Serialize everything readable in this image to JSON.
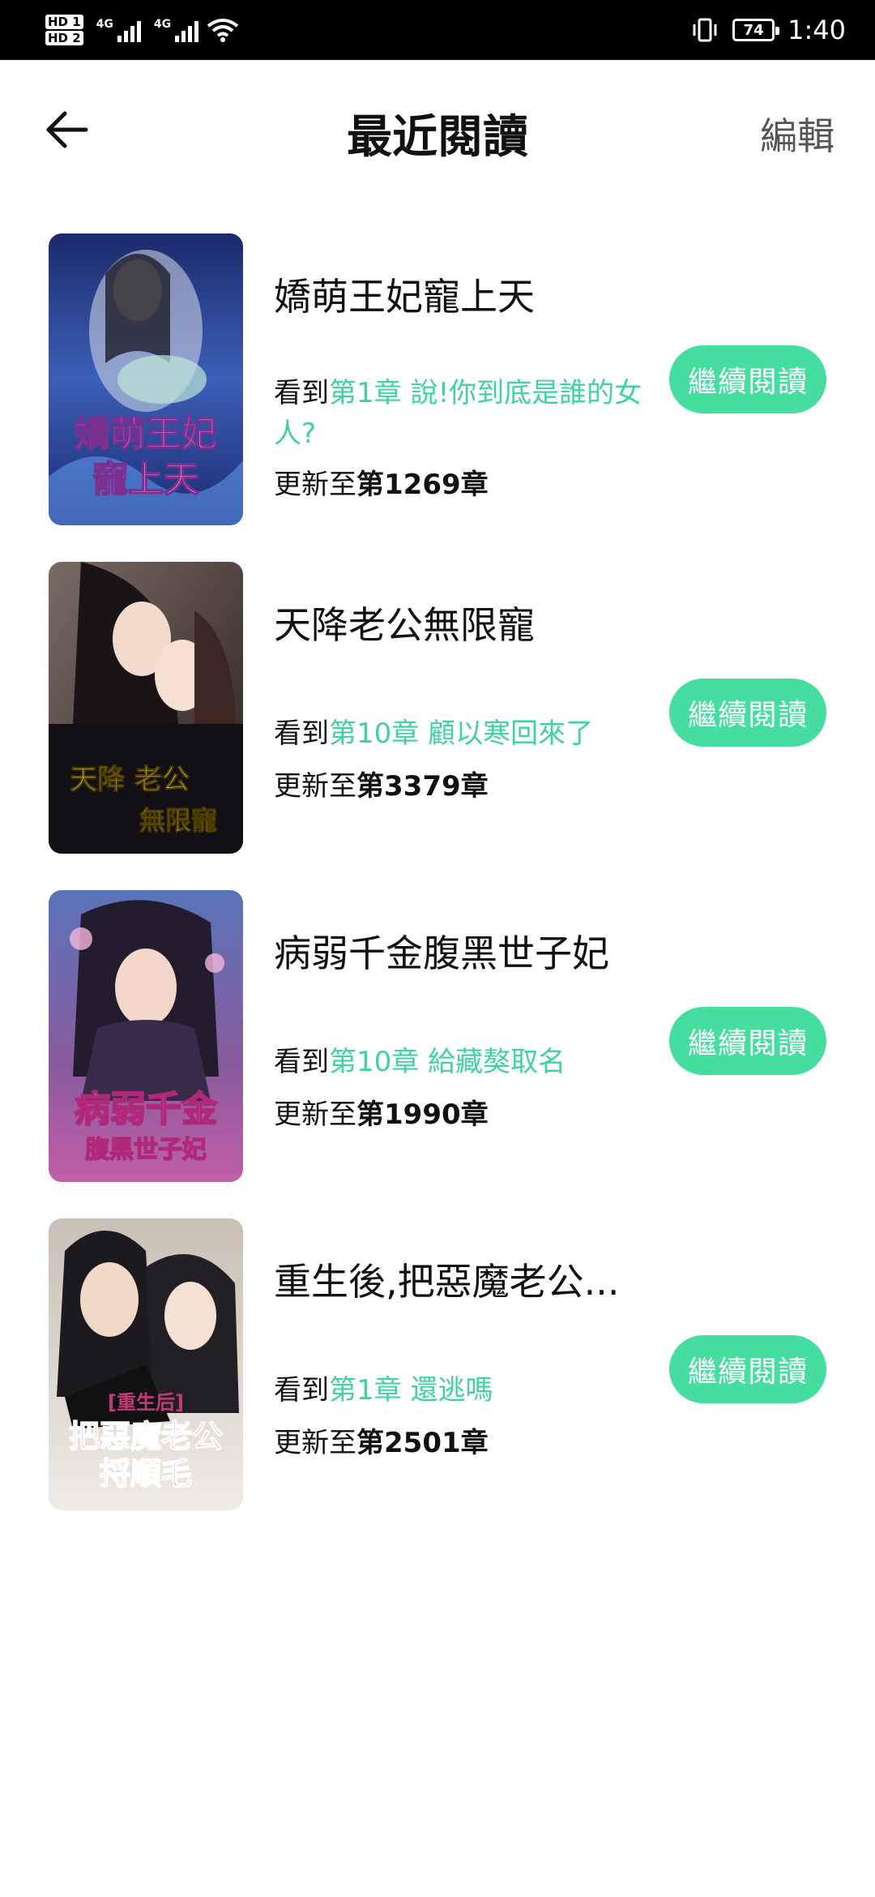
{
  "status_bar": {
    "hd1": "HD 1",
    "hd2": "HD 2",
    "net1": "4G",
    "net2": "4G",
    "battery": "74",
    "time": "1:40"
  },
  "header": {
    "title": "最近閱讀",
    "edit_label": "編輯"
  },
  "books": [
    {
      "title": "嬌萌王妃寵上天",
      "read_prefix": "看到",
      "read_chapter": "第1章 說!你到底是誰的女人?",
      "update_prefix": "更新至",
      "update_chapter": "第1269章",
      "button": "繼續閱讀",
      "cover_text_1": "嬌萌王妃",
      "cover_text_2": "寵上天"
    },
    {
      "title": "天降老公無限寵",
      "read_prefix": "看到",
      "read_chapter": "第10章 顧以寒回來了",
      "update_prefix": "更新至",
      "update_chapter": "第3379章",
      "button": "繼續閱讀",
      "cover_text_1": "天降 老公",
      "cover_text_2": "無限寵"
    },
    {
      "title": "病弱千金腹黑世子妃",
      "read_prefix": "看到",
      "read_chapter": "第10章 給藏獒取名",
      "update_prefix": "更新至",
      "update_chapter": "第1990章",
      "button": "繼續閱讀",
      "cover_text_1": "病弱千金",
      "cover_text_2": "腹黑世子妃"
    },
    {
      "title": "重生後,把惡魔老公...",
      "read_prefix": "看到",
      "read_chapter": "第1章 還逃嗎",
      "update_prefix": "更新至",
      "update_chapter": "第2501章",
      "button": "繼續閱讀",
      "cover_text_0": "[重生后]",
      "cover_text_1": "把惡魔老公",
      "cover_text_2": "捋順毛"
    }
  ],
  "colors": {
    "accent": "#45de9f",
    "highlight_text": "#3ed3a1"
  }
}
